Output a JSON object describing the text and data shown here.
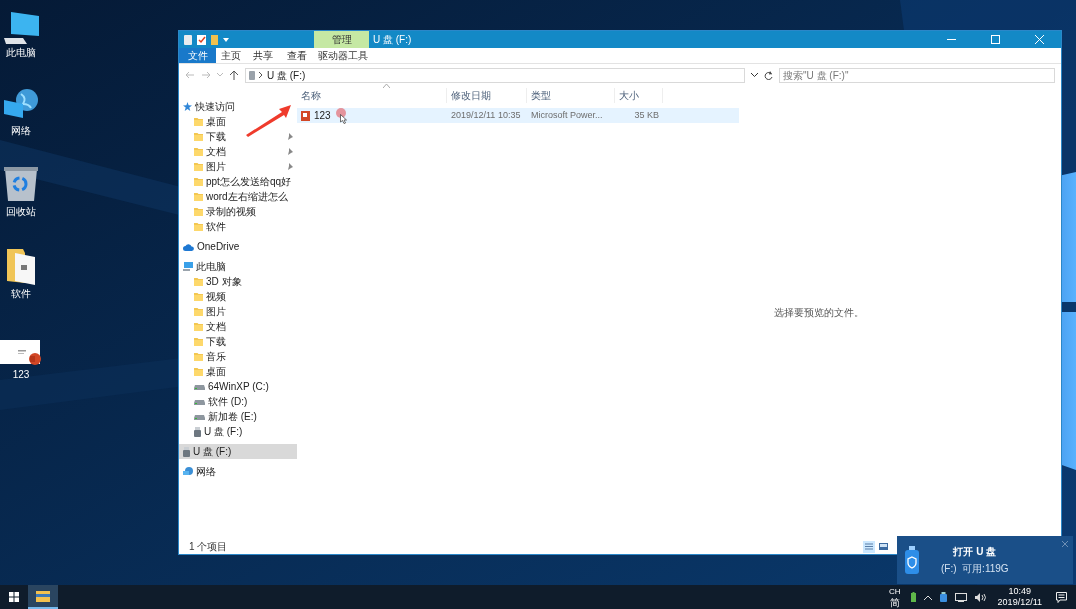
{
  "desktop": {
    "icons": [
      {
        "label": "此电脑",
        "kind": "pc"
      },
      {
        "label": "网络",
        "kind": "network"
      },
      {
        "label": "回收站",
        "kind": "recycle-bin"
      },
      {
        "label": "软件",
        "kind": "folder"
      },
      {
        "label": "123",
        "kind": "slides"
      }
    ]
  },
  "window": {
    "title": "U 盘 (F:)",
    "context_tab": "管理",
    "ribbon_tabs": [
      {
        "label": "文件",
        "kind": "menu"
      },
      {
        "label": "主页",
        "kind": "tab"
      },
      {
        "label": "共享",
        "kind": "tab"
      },
      {
        "label": "查看",
        "kind": "tab"
      },
      {
        "label": "驱动器工具",
        "kind": "tab"
      }
    ],
    "address": {
      "path": "U 盘 (F:)"
    },
    "search": {
      "placeholder": "搜索\"U 盘 (F:)\""
    },
    "nav": [
      {
        "label": "快速访问",
        "kind": "star",
        "selected": false,
        "children": [
          {
            "label": "桌面",
            "kind": "folder",
            "pinned": false,
            "selected": false
          },
          {
            "label": "下载",
            "kind": "folder",
            "pinned": true,
            "selected": false
          },
          {
            "label": "文档",
            "kind": "folder",
            "pinned": true,
            "selected": false
          },
          {
            "label": "图片",
            "kind": "folder",
            "pinned": true,
            "selected": false
          },
          {
            "label": "ppt怎么发送给qq好",
            "kind": "folder",
            "pinned": false,
            "selected": false
          },
          {
            "label": "word左右缩进怎么",
            "kind": "folder",
            "pinned": false,
            "selected": false
          },
          {
            "label": "录制的视频",
            "kind": "folder",
            "pinned": false,
            "selected": false
          },
          {
            "label": "软件",
            "kind": "folder",
            "pinned": false,
            "selected": false
          }
        ]
      },
      {
        "label": "OneDrive",
        "kind": "cloud",
        "selected": false
      },
      {
        "label": "此电脑",
        "kind": "pc",
        "selected": false,
        "children": [
          {
            "label": "3D 对象",
            "kind": "folder",
            "selected": false
          },
          {
            "label": "视频",
            "kind": "folder",
            "selected": false
          },
          {
            "label": "图片",
            "kind": "folder",
            "selected": false
          },
          {
            "label": "文档",
            "kind": "folder",
            "selected": false
          },
          {
            "label": "下载",
            "kind": "folder",
            "selected": false
          },
          {
            "label": "音乐",
            "kind": "folder",
            "selected": false
          },
          {
            "label": "桌面",
            "kind": "folder",
            "selected": false
          },
          {
            "label": "64WinXP  (C:)",
            "kind": "drive",
            "selected": false
          },
          {
            "label": "软件 (D:)",
            "kind": "drive",
            "selected": false
          },
          {
            "label": "新加卷 (E:)",
            "kind": "drive",
            "selected": false
          },
          {
            "label": "U 盘 (F:)",
            "kind": "usb",
            "selected": false
          }
        ]
      },
      {
        "label": "U 盘 (F:)",
        "kind": "usb",
        "selected": true
      },
      {
        "label": "网络",
        "kind": "network",
        "selected": false
      }
    ],
    "file_list": {
      "columns": [
        "名称",
        "修改日期",
        "类型",
        "大小"
      ],
      "rows": [
        {
          "name": "123",
          "modified": "2019/12/11 10:35",
          "type": "Microsoft Power...",
          "size": "35 KB",
          "selected": true
        }
      ]
    },
    "preview": {
      "message": "选择要预览的文件。"
    },
    "status_bar": {
      "item_count": "1 个项目"
    }
  },
  "toast": {
    "title": "打开 U 盘",
    "detail": "(F:)  可用:119G"
  },
  "taskbar": {
    "input_language": "CH",
    "input_mode": "简",
    "time": "10:49",
    "date": "2019/12/11"
  }
}
